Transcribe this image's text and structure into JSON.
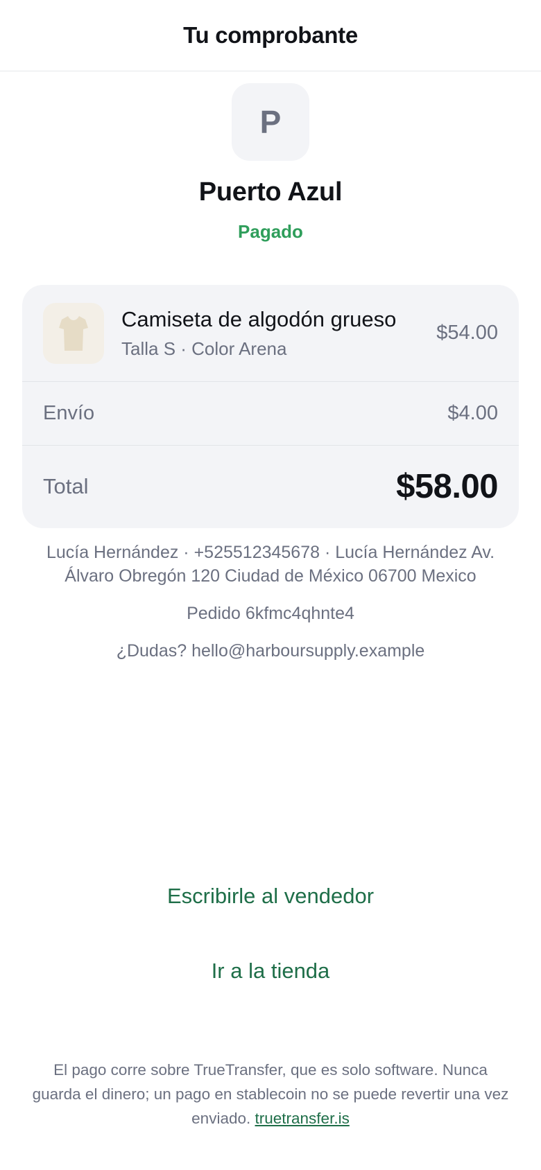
{
  "header": {
    "title": "Tu comprobante"
  },
  "merchant": {
    "initial": "P",
    "name": "Puerto Azul",
    "status": "Pagado"
  },
  "order": {
    "item": {
      "icon": "tshirt-icon",
      "name": "Camiseta de algodón grueso",
      "variant": "Talla S · Color Arena",
      "price": "$54.00"
    },
    "shipping": {
      "label": "Envío",
      "value": "$4.00"
    },
    "total": {
      "label": "Total",
      "value": "$58.00"
    }
  },
  "info": {
    "address_line1": "Lucía Hernández · +525512345678 · Lucía Hernández Av.",
    "address_line2": "Álvaro Obregón 120 Ciudad de México 06700 Mexico",
    "order_id": "Pedido 6kfmc4qhnte4",
    "contact": "¿Dudas? hello@harboursupply.example"
  },
  "actions": {
    "message_seller": "Escribirle al vendedor",
    "go_to_store": "Ir a la tienda"
  },
  "footer": {
    "text": "El pago corre sobre TrueTransfer, que es solo software. Nunca guarda el dinero; un pago en stablecoin no se puede revertir una vez enviado.",
    "link": "truetransfer.is"
  },
  "colors": {
    "accent_green": "#1e6e48",
    "status_green": "#2f9e5b",
    "card_background": "#f3f4f7",
    "muted_text": "#6b7080"
  }
}
